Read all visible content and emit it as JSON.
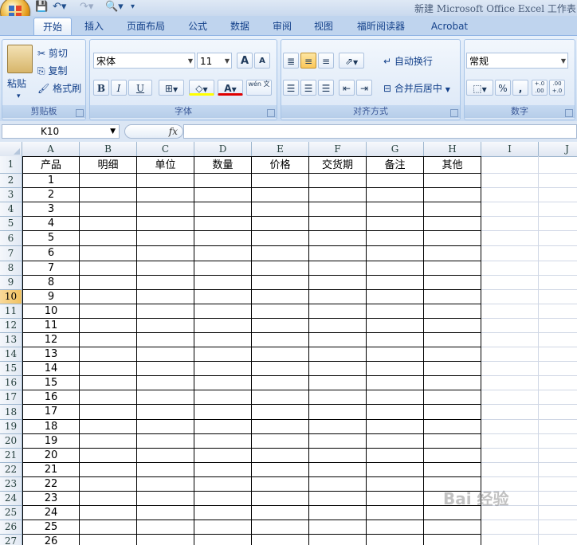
{
  "window": {
    "title": "新建 Microsoft Office Excel 工作表"
  },
  "tabs": [
    {
      "label": "开始",
      "active": true
    },
    {
      "label": "插入"
    },
    {
      "label": "页面布局"
    },
    {
      "label": "公式"
    },
    {
      "label": "数据"
    },
    {
      "label": "审阅"
    },
    {
      "label": "视图"
    },
    {
      "label": "福昕阅读器"
    },
    {
      "label": "Acrobat"
    }
  ],
  "ribbon": {
    "clipboard": {
      "group": "剪贴板",
      "paste": "粘贴",
      "cut": "剪切",
      "copy": "复制",
      "format_painter": "格式刷"
    },
    "font": {
      "group": "字体",
      "font_name": "宋体",
      "font_size": "11",
      "bold": "B",
      "italic": "I",
      "underline": "U",
      "grow": "A",
      "shrink": "A",
      "font_color": "A",
      "phonetic": "wén 文"
    },
    "alignment": {
      "group": "对齐方式",
      "wrap_text": "自动换行",
      "merge_center": "合并后居中"
    },
    "number": {
      "group": "数字",
      "format": "常规",
      "percent": "%",
      "comma": ",",
      "inc_decimal": "+.0 .00",
      "dec_decimal": ".00 +.0"
    }
  },
  "formula_bar": {
    "name_box": "K10",
    "fx": "fx",
    "value": ""
  },
  "columns": [
    "A",
    "B",
    "C",
    "D",
    "E",
    "F",
    "G",
    "H",
    "I",
    "J"
  ],
  "selected_row": 10,
  "headers": [
    "产品",
    "明细",
    "单位",
    "数量",
    "价格",
    "交货期",
    "备注",
    "其他"
  ],
  "rows": [
    "1",
    "2",
    "3",
    "4",
    "5",
    "6",
    "7",
    "8",
    "9",
    "10",
    "11",
    "12",
    "13",
    "14",
    "15",
    "16",
    "17",
    "18",
    "19",
    "20",
    "21",
    "22",
    "23",
    "24",
    "25",
    "26"
  ],
  "row_numbers": [
    "1",
    "2",
    "3",
    "4",
    "5",
    "6",
    "7",
    "8",
    "9",
    "10",
    "11",
    "12",
    "13",
    "14",
    "15",
    "16",
    "17",
    "18",
    "19",
    "20",
    "21",
    "22",
    "23",
    "24",
    "25",
    "26",
    "27"
  ],
  "watermark": "Bai 经验"
}
